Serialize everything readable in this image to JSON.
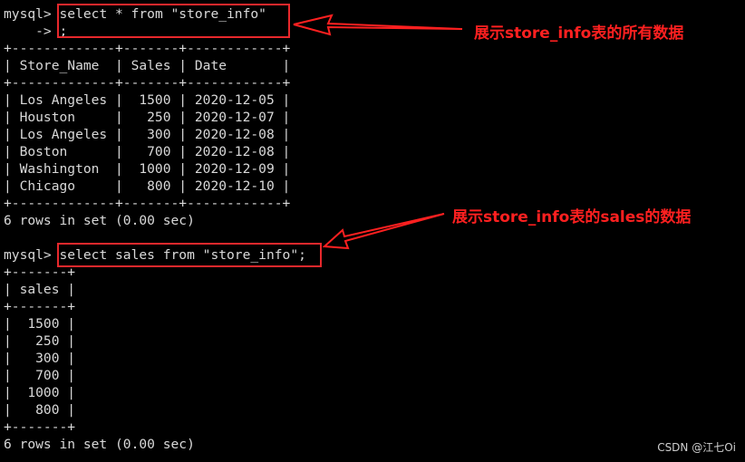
{
  "terminal": {
    "query1": {
      "prompt": "mysql>",
      "command": "select * from \"store_info\"",
      "continuation_prompt": "    ->",
      "continuation": ";",
      "table_border": "+-------------+-------+------------+",
      "header_row": "| Store_Name  | Sales | Date       |",
      "rows": [
        "| Los Angeles |  1500 | 2020-12-05 |",
        "| Houston     |   250 | 2020-12-07 |",
        "| Los Angeles |   300 | 2020-12-08 |",
        "| Boston      |   700 | 2020-12-08 |",
        "| Washington  |  1000 | 2020-12-09 |",
        "| Chicago     |   800 | 2020-12-10 |"
      ],
      "result": "6 rows in set (0.00 sec)"
    },
    "query2": {
      "prompt": "mysql>",
      "command": "select sales from \"store_info\";",
      "table_border": "+-------+",
      "header_row": "| sales |",
      "rows": [
        "|  1500 |",
        "|   250 |",
        "|   300 |",
        "|   700 |",
        "|  1000 |",
        "|   800 |"
      ],
      "result": "6 rows in set (0.00 sec)"
    }
  },
  "annotations": {
    "first": "展示store_info表的所有数据",
    "second": "展示store_info表的sales的数据"
  },
  "watermark": "CSDN @江七Oi",
  "colors": {
    "background": "#000000",
    "terminal_text": "#d9d9d9",
    "annotation": "#ff2020",
    "highlight_box": "#e8282c"
  }
}
